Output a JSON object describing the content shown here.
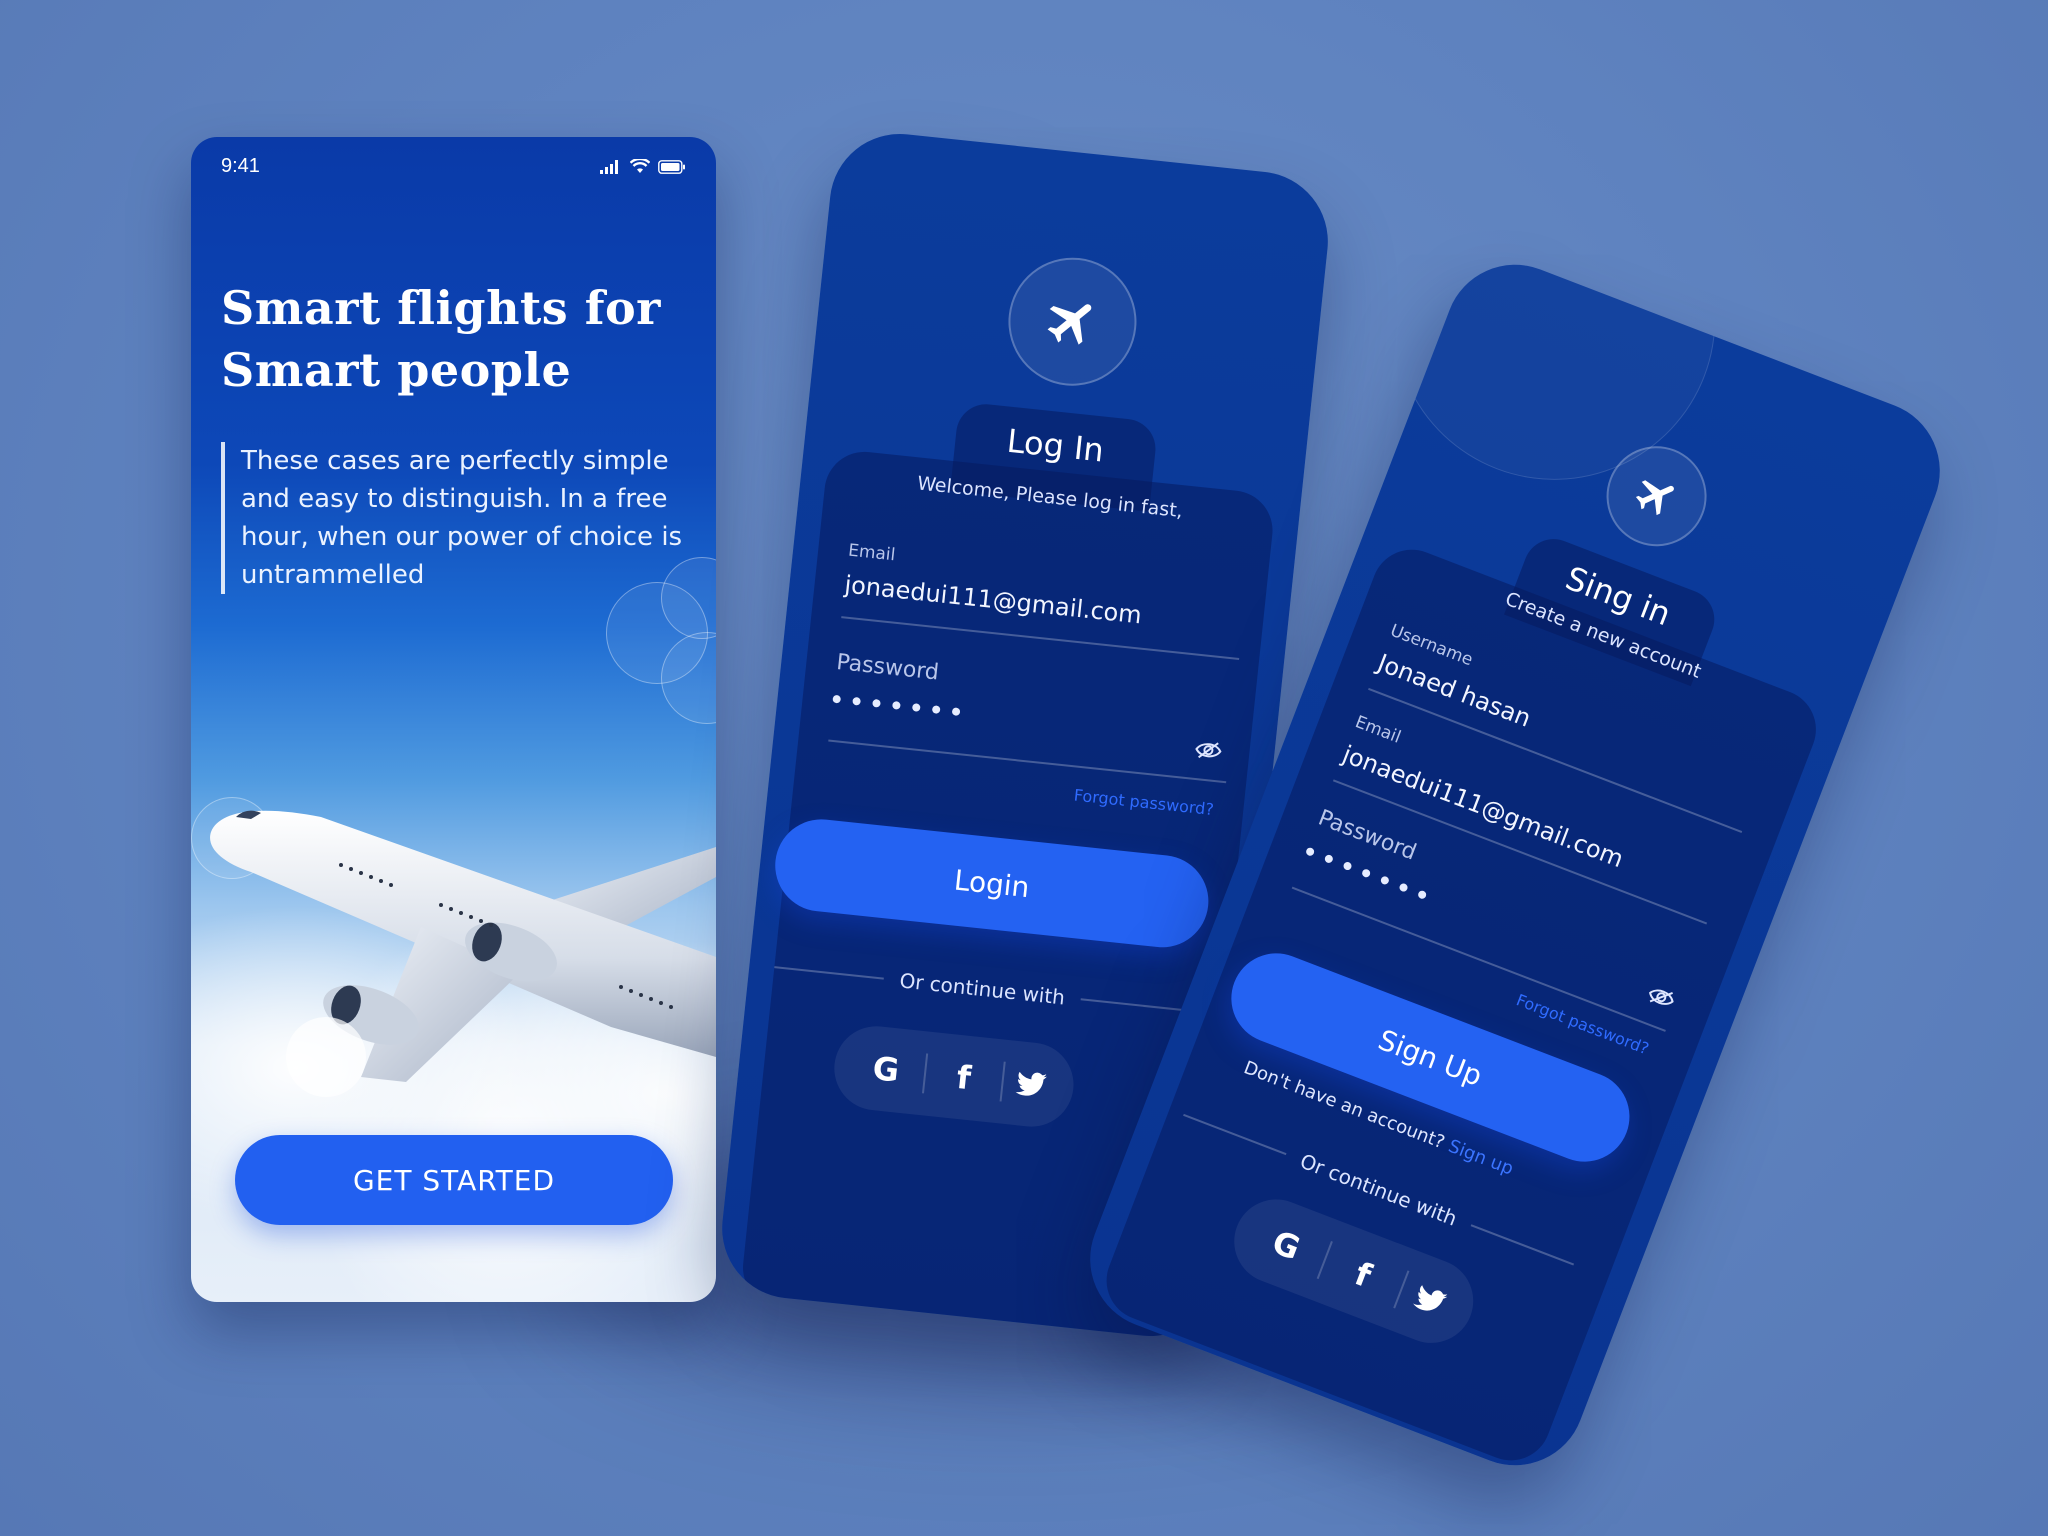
{
  "colors": {
    "background": "#5e82bf",
    "accent": "#2462f2",
    "dark_card": "#0a3491",
    "link": "#2f6bff"
  },
  "welcome": {
    "status_time": "9:41",
    "status_icons": [
      "signal-icon",
      "wifi-icon",
      "battery-icon"
    ],
    "title_line1": "Smart flights for",
    "title_line2": "Smart people",
    "description": "These cases are perfectly simple and easy to distinguish. In a free hour, when our power of choice is untrammelled",
    "cta_label": "GET STARTED"
  },
  "login": {
    "logo_icon": "airplane-icon",
    "title": "Log In",
    "subtitle": "Welcome, Please log in fast,",
    "email_label": "Email",
    "email_value": "jonaedui111@gmail.com",
    "password_label": "Password",
    "password_mask_length": 7,
    "forgot_label": "Forgot password?",
    "button_label": "Login",
    "continue_label": "Or continue with",
    "social": [
      "G",
      "f",
      "twitter-icon"
    ]
  },
  "signin": {
    "logo_icon": "airplane-icon",
    "title": "Sing in",
    "subtitle": "Create a new account",
    "username_label": "Username",
    "username_value": "Jonaed hasan",
    "email_label": "Email",
    "email_value": "jonaedui111@gmail.com",
    "password_label": "Password",
    "password_mask_length": 7,
    "forgot_label": "Forgot password?",
    "button_label": "Sign Up",
    "no_account_text": "Don't have an account?",
    "signup_link": "Sign up",
    "continue_label": "Or continue with",
    "social": [
      "G",
      "f",
      "twitter-icon"
    ]
  }
}
